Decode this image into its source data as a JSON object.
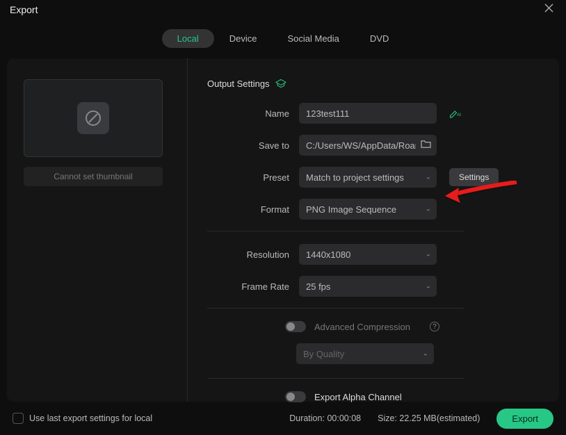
{
  "header": {
    "title": "Export"
  },
  "tabs": [
    "Local",
    "Device",
    "Social Media",
    "DVD"
  ],
  "active_tab_index": 0,
  "thumbnail": {
    "button_label": "Cannot set thumbnail"
  },
  "section": {
    "title": "Output Settings"
  },
  "form": {
    "name": {
      "label": "Name",
      "value": "123test111"
    },
    "save_to": {
      "label": "Save to",
      "value": "C:/Users/WS/AppData/Roamin"
    },
    "preset": {
      "label": "Preset",
      "value": "Match to project settings"
    },
    "settings_btn": "Settings",
    "format": {
      "label": "Format",
      "value": "PNG Image Sequence"
    },
    "resolution": {
      "label": "Resolution",
      "value": "1440x1080"
    },
    "frame_rate": {
      "label": "Frame Rate",
      "value": "25 fps"
    },
    "advanced_compression": {
      "label": "Advanced Compression"
    },
    "quality": {
      "value": "By Quality"
    },
    "export_alpha": {
      "label": "Export Alpha Channel"
    }
  },
  "footer": {
    "use_last_label": "Use last export settings for local",
    "duration_label": "Duration:",
    "duration_value": "00:00:08",
    "size_label": "Size:",
    "size_value": "22.25 MB(estimated)",
    "export_btn": "Export"
  }
}
